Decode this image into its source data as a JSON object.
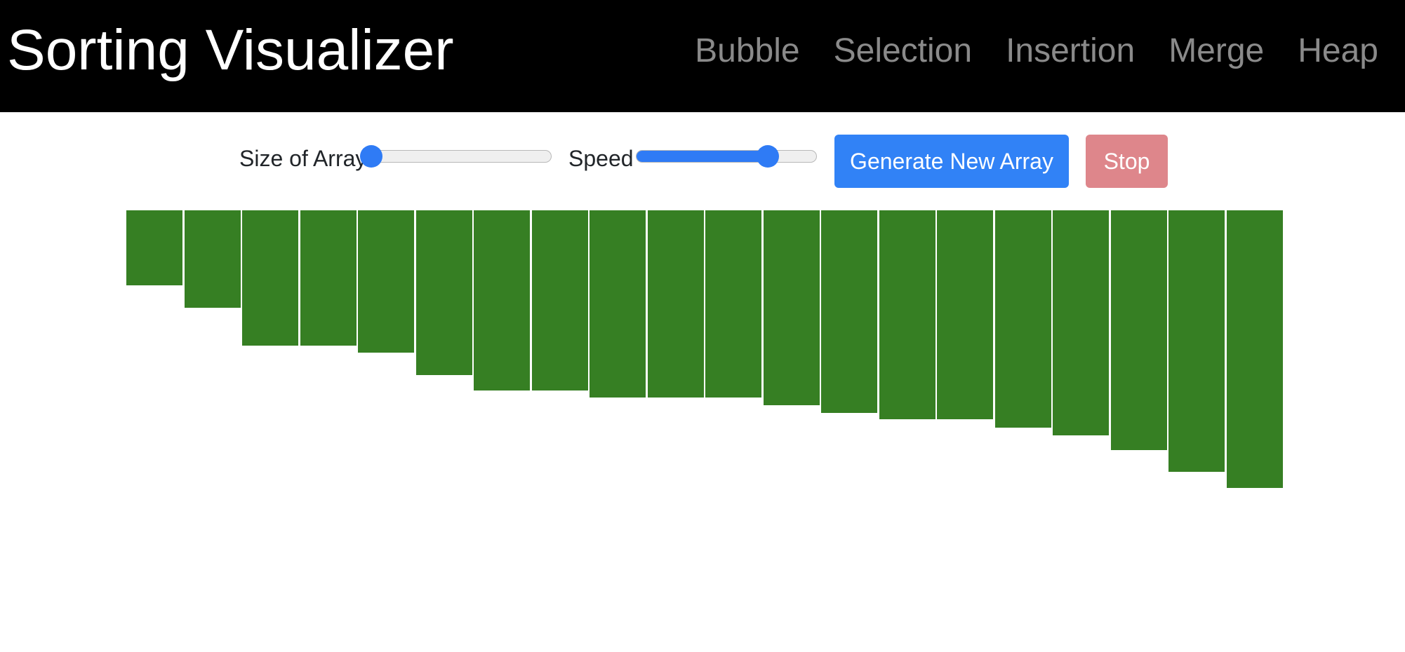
{
  "app": {
    "title": "Sorting Visualizer"
  },
  "nav": {
    "items": [
      {
        "label": "Bubble"
      },
      {
        "label": "Selection"
      },
      {
        "label": "Insertion"
      },
      {
        "label": "Merge"
      },
      {
        "label": "Heap"
      }
    ]
  },
  "controls": {
    "size_label": "Size of Array",
    "size_value_fraction": 0.0,
    "speed_label": "Speed",
    "speed_value_fraction": 0.73,
    "generate_label": "Generate New Array",
    "stop_label": "Stop"
  },
  "colors": {
    "navbar_bg": "#000000",
    "nav_link": "#8a8a8a",
    "accent": "#3182f6",
    "stop": "#de868b",
    "bar": "#367f23"
  },
  "array": {
    "values": [
      107,
      139,
      193,
      193,
      203,
      235,
      257,
      257,
      267,
      267,
      267,
      278,
      289,
      298,
      298,
      310,
      321,
      342,
      373,
      396
    ]
  }
}
